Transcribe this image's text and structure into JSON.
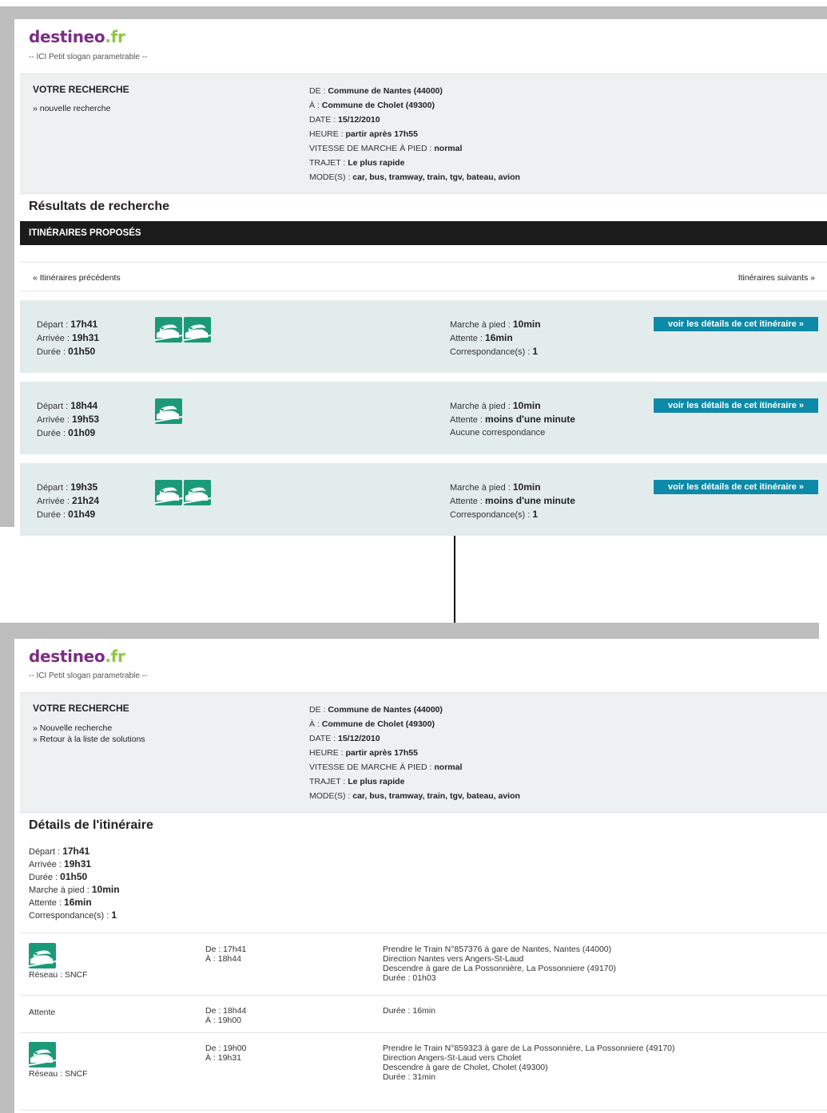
{
  "brand": {
    "name_part1": "destineo",
    "name_part2": ".fr",
    "slogan": "-- ICI Petit slogan parametrable --"
  },
  "search": {
    "title": "VOTRE RECHERCHE",
    "new_search_link_1": "» nouvelle recherche",
    "new_search_link_2": "» Nouvelle recherche",
    "back_to_list_link": "» Retour à la liste de solutions",
    "criteria": [
      {
        "label": "DE : ",
        "value": "Commune de Nantes (44000)"
      },
      {
        "label": "À : ",
        "value": "Commune de Cholet (49300)"
      },
      {
        "label": "DATE : ",
        "value": "15/12/2010"
      },
      {
        "label": "HEURE : ",
        "value": "partir après 17h55"
      },
      {
        "label": "VITESSE DE MARCHE À PIED : ",
        "value": "normal"
      },
      {
        "label": "TRAJET : ",
        "value": "Le plus rapide"
      },
      {
        "label": "MODE(S) : ",
        "value": "car, bus, tramway, train, tgv, bateau, avion"
      }
    ]
  },
  "results": {
    "title": "Résultats de recherche",
    "header": "ITINÉRAIRES PROPOSÉS",
    "prev_link": "« Itinéraires précédents",
    "next_link": "Itinéraires suivants »",
    "details_button": "voir les détails de cet itinéraire »",
    "labels": {
      "depart": "Départ : ",
      "arrivee": "Arrivée : ",
      "duree": "Durée : ",
      "marche": "Marche à pied : ",
      "attente": "Attente : ",
      "corresp": "Correspondance(s) : "
    },
    "itineraries": [
      {
        "depart": "17h41",
        "arrivee": "19h31",
        "duree": "01h50",
        "marche": "10min",
        "attente": "16min",
        "corresp_text": "",
        "corresp": "1",
        "icons": [
          "train-icon",
          "train-icon"
        ]
      },
      {
        "depart": "18h44",
        "arrivee": "19h53",
        "duree": "01h09",
        "marche": "10min",
        "attente": "moins d'une minute",
        "corresp_text": "Aucune correspondance",
        "corresp": "",
        "icons": [
          "train-icon"
        ]
      },
      {
        "depart": "19h35",
        "arrivee": "21h24",
        "duree": "01h49",
        "marche": "10min",
        "attente": "moins d'une minute",
        "corresp_text": "",
        "corresp": "1",
        "icons": [
          "train-icon",
          "train-icon"
        ]
      }
    ]
  },
  "details": {
    "title": "Détails de l'itinéraire",
    "summary": [
      {
        "label": "Départ : ",
        "value": "17h41"
      },
      {
        "label": "Arrivée : ",
        "value": "19h31"
      },
      {
        "label": "Durée : ",
        "value": "01h50"
      },
      {
        "label": "Marche à pied : ",
        "value": "10min"
      },
      {
        "label": "Attente : ",
        "value": "16min"
      },
      {
        "label": "Correspondance(s) : ",
        "value": "1"
      }
    ],
    "segments": [
      {
        "type": "train",
        "network": "Réseau : SNCF",
        "de": "De : 17h41",
        "a": "À : 18h44",
        "lines": [
          "Prendre le Train N°857376 à gare de Nantes, Nantes (44000)",
          "Direction Nantes vers Angers-St-Laud",
          "Descendre à gare de La Possonnière, La Possonniere (49170)",
          "Durée : 01h03"
        ]
      },
      {
        "type": "wait",
        "label": "Attente",
        "de": "De : 18h44",
        "a": "À : 19h00",
        "lines": [
          "Durée : 16min"
        ]
      },
      {
        "type": "train",
        "network": "Réseau : SNCF",
        "de": "De : 19h00",
        "a": "À : 19h31",
        "lines": [
          "Prendre le Train N°859323 à gare de La Possonnière, La Possonniere (49170)",
          "Direction Angers-St-Laud vers Cholet",
          "Descendre à gare de Cholet, Cholet (49300)",
          "Durée : 31min"
        ]
      }
    ]
  },
  "colors": {
    "brand_purple": "#7b2d83",
    "brand_green": "#8dc63f",
    "button_teal": "#0c8aa8",
    "icon_green": "#1a9a78",
    "card_bg": "#e3eced"
  }
}
